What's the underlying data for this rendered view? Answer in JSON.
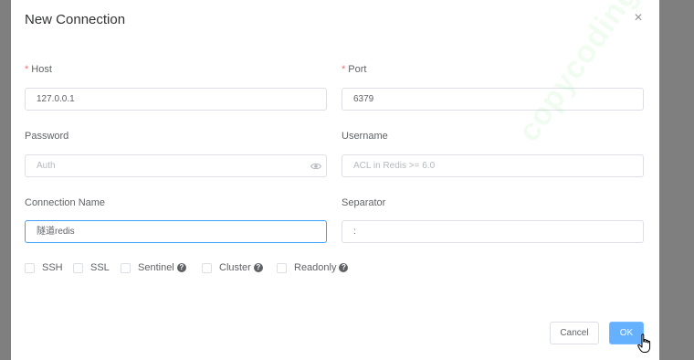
{
  "dialog": {
    "title": "New Connection",
    "close_glyph": "×"
  },
  "form": {
    "host": {
      "label": "Host",
      "required_mark": "*",
      "value": "127.0.0.1"
    },
    "port": {
      "label": "Port",
      "required_mark": "*",
      "value": "6379"
    },
    "password": {
      "label": "Password",
      "placeholder": "Auth",
      "icon": "eye-icon"
    },
    "username": {
      "label": "Username",
      "placeholder": "ACL in Redis >= 6.0"
    },
    "connection_name": {
      "label": "Connection Name",
      "value": "隧道redis"
    },
    "separator": {
      "label": "Separator",
      "value": ":"
    }
  },
  "options": {
    "ssh": "SSH",
    "ssl": "SSL",
    "sentinel": "Sentinel",
    "cluster": "Cluster",
    "readonly": "Readonly",
    "help_glyph": "?"
  },
  "buttons": {
    "cancel": "Cancel",
    "ok": "OK"
  },
  "watermark": "copycoding",
  "colors": {
    "primary": "#409eff",
    "required": "#f56c6c",
    "border": "#dcdfe6",
    "overlay": "#7f7f7f"
  }
}
